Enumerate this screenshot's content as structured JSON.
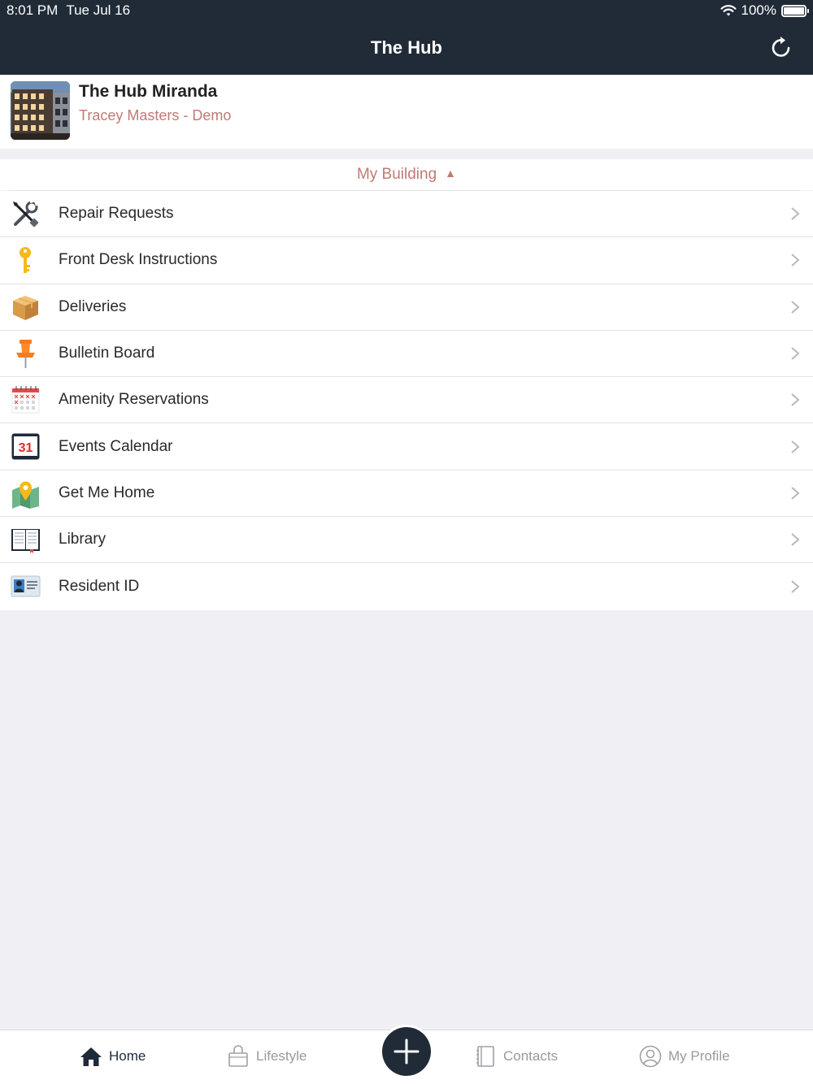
{
  "status_bar": {
    "time": "8:01 PM",
    "date": "Tue Jul 16",
    "battery": "100%"
  },
  "header": {
    "title": "The Hub"
  },
  "building": {
    "name": "The Hub Miranda",
    "user": "Tracey Masters - Demo"
  },
  "section": {
    "title": "My Building",
    "caret": "▲"
  },
  "menu": [
    {
      "label": "Repair Requests",
      "icon": "tools-icon"
    },
    {
      "label": "Front Desk Instructions",
      "icon": "key-icon"
    },
    {
      "label": "Deliveries",
      "icon": "package-icon"
    },
    {
      "label": "Bulletin Board",
      "icon": "pushpin-icon"
    },
    {
      "label": "Amenity Reservations",
      "icon": "calendar-grid-icon"
    },
    {
      "label": "Events Calendar",
      "icon": "calendar-31-icon",
      "icon_text": "31"
    },
    {
      "label": "Get Me Home",
      "icon": "map-pin-icon"
    },
    {
      "label": "Library",
      "icon": "book-icon"
    },
    {
      "label": "Resident ID",
      "icon": "id-card-icon"
    }
  ],
  "tabs": [
    {
      "label": "Home",
      "icon": "home-icon",
      "active": true
    },
    {
      "label": "Lifestyle",
      "icon": "bag-icon",
      "active": false
    },
    {
      "label": "Contacts",
      "icon": "contacts-book-icon",
      "active": false
    },
    {
      "label": "My Profile",
      "icon": "user-circle-icon",
      "active": false
    }
  ],
  "colors": {
    "nav_bg": "#212b38",
    "accent": "#c07a74",
    "background": "#efeff4"
  }
}
